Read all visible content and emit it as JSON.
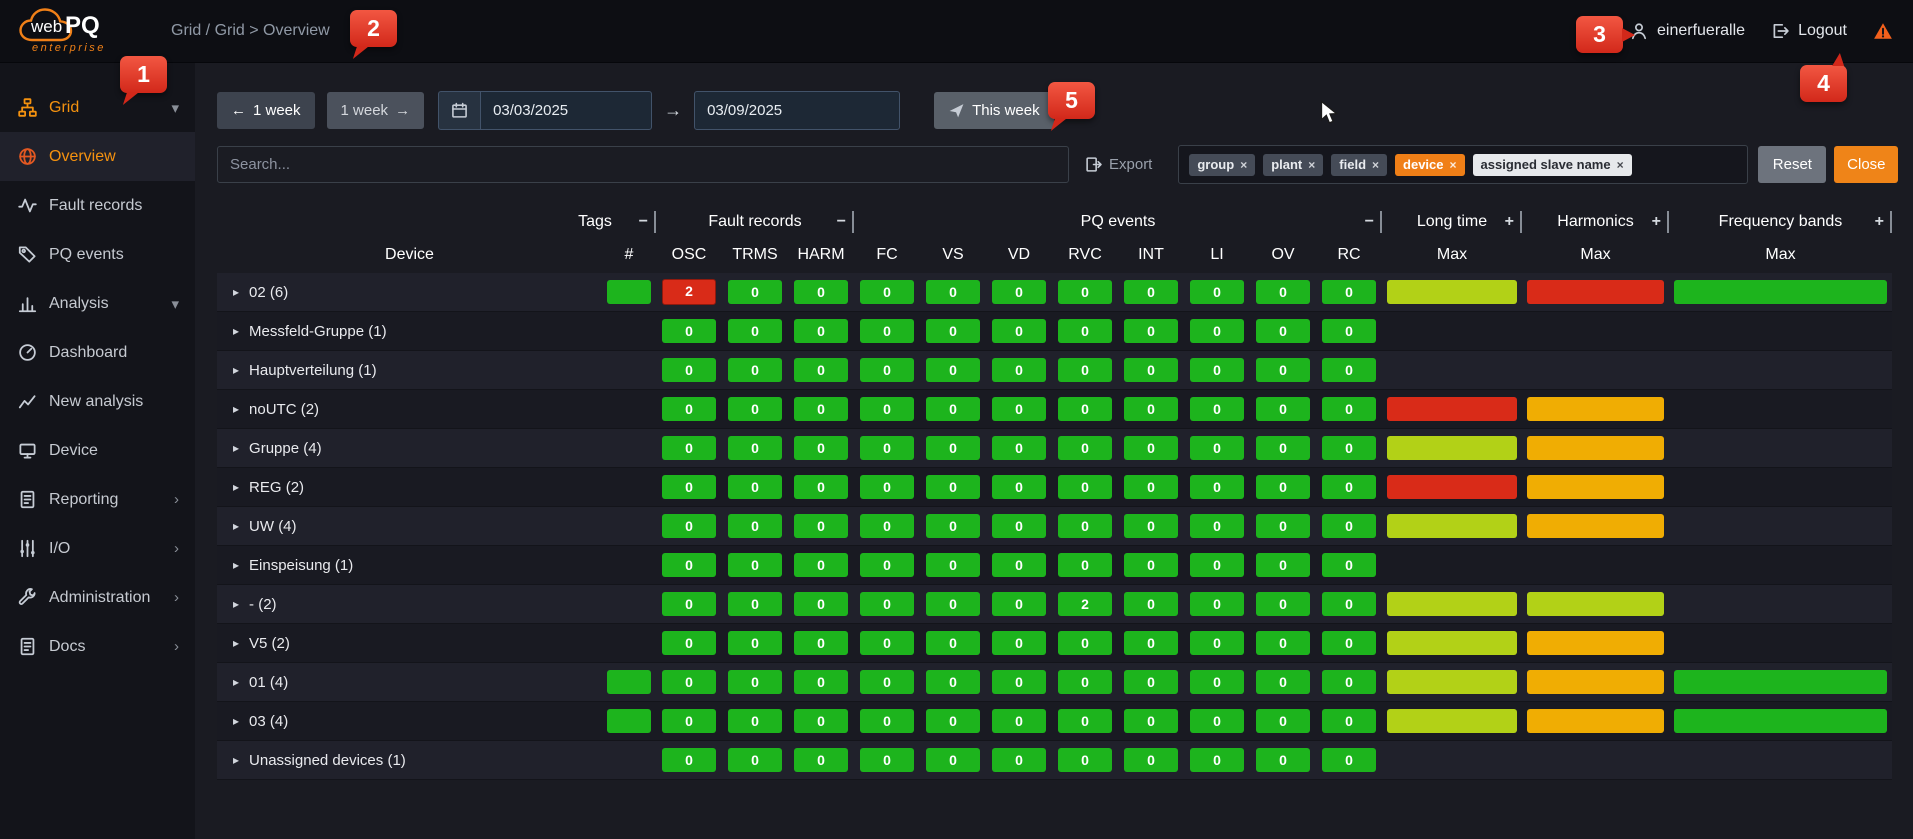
{
  "app": {
    "logo": {
      "part1": "web",
      "part2": "PQ",
      "subtitle": "enterprise"
    },
    "breadcrumb": "Grid / Grid > Overview",
    "user": "einerfueralle",
    "logout_label": "Logout"
  },
  "sidebar": {
    "items": [
      {
        "label": "Grid",
        "icon": "sitemap-icon",
        "chevron": "down",
        "active": true
      },
      {
        "label": "Overview",
        "icon": "globe-icon",
        "selected": true
      },
      {
        "label": "Fault records",
        "icon": "waveform-icon"
      },
      {
        "label": "PQ events",
        "icon": "tags-icon"
      },
      {
        "label": "Analysis",
        "icon": "bar-chart-icon",
        "chevron": "down"
      },
      {
        "label": "Dashboard",
        "icon": "gauge-icon"
      },
      {
        "label": "New analysis",
        "icon": "line-chart-icon"
      },
      {
        "label": "Device",
        "icon": "device-icon"
      },
      {
        "label": "Reporting",
        "icon": "report-icon",
        "chevron": "right"
      },
      {
        "label": "I/O",
        "icon": "io-icon",
        "chevron": "right"
      },
      {
        "label": "Administration",
        "icon": "wrench-icon",
        "chevron": "right"
      },
      {
        "label": "Docs",
        "icon": "docs-icon",
        "chevron": "right"
      }
    ]
  },
  "toolbar": {
    "prev_week_label": "1 week",
    "next_week_label": "1 week",
    "date_from": "03/03/2025",
    "date_to": "03/09/2025",
    "this_week_label": "This week"
  },
  "filterbar": {
    "search_placeholder": "Search...",
    "export_label": "Export",
    "tags": [
      {
        "label": "group",
        "style": "dark"
      },
      {
        "label": "plant",
        "style": "dark"
      },
      {
        "label": "field",
        "style": "dark"
      },
      {
        "label": "device",
        "style": "orange"
      },
      {
        "label": "assigned slave name",
        "style": "light"
      }
    ],
    "reset_label": "Reset",
    "close_label": "Close"
  },
  "table": {
    "groups": [
      {
        "label": "Tags",
        "icon": "collapse"
      },
      {
        "label": "Fault records",
        "icon": "collapse"
      },
      {
        "label": "PQ events",
        "icon": "collapse"
      },
      {
        "label": "Long time",
        "icon": "expand"
      },
      {
        "label": "Harmonics",
        "icon": "expand"
      },
      {
        "label": "Frequency bands",
        "icon": "expand"
      }
    ],
    "columns": [
      "Device",
      "#",
      "OSC",
      "TRMS",
      "HARM",
      "FC",
      "VS",
      "VD",
      "RVC",
      "INT",
      "LI",
      "OV",
      "RC",
      "Max",
      "Max",
      "Max"
    ],
    "rows": [
      {
        "name": "02 (6)",
        "tag": true,
        "counts": [
          {
            "v": 2,
            "c": "red"
          },
          0,
          0,
          0,
          0,
          0,
          0,
          0,
          0,
          0,
          0
        ],
        "long": "chartreuse",
        "harm": "red",
        "freq": "green"
      },
      {
        "name": "Messfeld-Gruppe (1)",
        "counts": [
          0,
          0,
          0,
          0,
          0,
          0,
          0,
          0,
          0,
          0,
          0
        ]
      },
      {
        "name": "Hauptverteilung (1)",
        "counts": [
          0,
          0,
          0,
          0,
          0,
          0,
          0,
          0,
          0,
          0,
          0
        ]
      },
      {
        "name": "noUTC (2)",
        "counts": [
          0,
          0,
          0,
          0,
          0,
          0,
          0,
          0,
          0,
          0,
          0
        ],
        "long": "red",
        "harm": "amber"
      },
      {
        "name": "Gruppe (4)",
        "counts": [
          0,
          0,
          0,
          0,
          0,
          0,
          0,
          0,
          0,
          0,
          0
        ],
        "long": "chartreuse",
        "harm": "amber"
      },
      {
        "name": "REG (2)",
        "counts": [
          0,
          0,
          0,
          0,
          0,
          0,
          0,
          0,
          0,
          0,
          0
        ],
        "long": "red",
        "harm": "amber"
      },
      {
        "name": "UW (4)",
        "counts": [
          0,
          0,
          0,
          0,
          0,
          0,
          0,
          0,
          0,
          0,
          0
        ],
        "long": "chartreuse",
        "harm": "amber"
      },
      {
        "name": "Einspeisung (1)",
        "counts": [
          0,
          0,
          0,
          0,
          0,
          0,
          0,
          0,
          0,
          0,
          0
        ]
      },
      {
        "name": "- (2)",
        "counts": [
          0,
          0,
          0,
          0,
          0,
          0,
          2,
          0,
          0,
          0,
          0
        ],
        "long": "chartreuse",
        "harm": "chartreuse"
      },
      {
        "name": "V5 (2)",
        "counts": [
          0,
          0,
          0,
          0,
          0,
          0,
          0,
          0,
          0,
          0,
          0
        ],
        "long": "chartreuse",
        "harm": "amber"
      },
      {
        "name": "01 (4)",
        "tag": true,
        "counts": [
          0,
          0,
          0,
          0,
          0,
          0,
          0,
          0,
          0,
          0,
          0
        ],
        "long": "chartreuse",
        "harm": "amber",
        "freq": "green"
      },
      {
        "name": "03 (4)",
        "tag": true,
        "counts": [
          0,
          0,
          0,
          0,
          0,
          0,
          0,
          0,
          0,
          0,
          0
        ],
        "long": "chartreuse",
        "harm": "amber",
        "freq": "green"
      },
      {
        "name": "Unassigned devices (1)",
        "counts": [
          0,
          0,
          0,
          0,
          0,
          0,
          0,
          0,
          0,
          0,
          0
        ]
      }
    ]
  },
  "colors": {
    "green": "#1db41d",
    "red": "#d92b18",
    "red_border": "#8f1a0e",
    "chartreuse": "#b2d117",
    "amber": "#f0ad03",
    "accent_orange": "#f08018"
  },
  "annotations": [
    {
      "n": "1"
    },
    {
      "n": "2"
    },
    {
      "n": "3"
    },
    {
      "n": "4"
    },
    {
      "n": "5"
    }
  ]
}
